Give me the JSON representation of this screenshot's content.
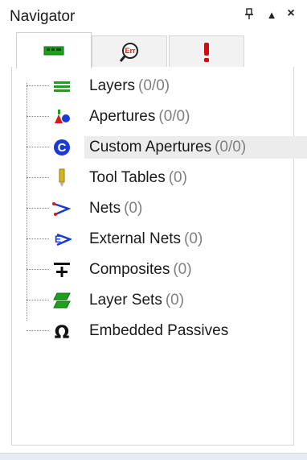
{
  "window": {
    "title": "Navigator",
    "pin_glyph": "ᵾ",
    "max_glyph": "▲",
    "close_glyph": "×"
  },
  "tabs": [
    {
      "name": "layers-tab",
      "icon": "pcb-board-icon",
      "active": true
    },
    {
      "name": "errors-tab",
      "icon": "magnifier-err-icon",
      "active": false
    },
    {
      "name": "alerts-tab",
      "icon": "exclamation-icon",
      "active": false
    }
  ],
  "tree": {
    "items": [
      {
        "label": "Layers",
        "count": "(0/0)",
        "icon": "layers-icon"
      },
      {
        "label": "Apertures",
        "count": "(0/0)",
        "icon": "apertures-icon"
      },
      {
        "label": "Custom Apertures",
        "count": "(0/0)",
        "icon": "custom-apertures-icon"
      },
      {
        "label": "Tool Tables",
        "count": "(0)",
        "icon": "tool-tables-icon"
      },
      {
        "label": "Nets",
        "count": "(0)",
        "icon": "nets-icon"
      },
      {
        "label": "External Nets",
        "count": "(0)",
        "icon": "external-nets-icon"
      },
      {
        "label": "Composites",
        "count": "(0)",
        "icon": "composites-icon"
      },
      {
        "label": "Layer Sets",
        "count": "(0)",
        "icon": "layer-sets-icon"
      },
      {
        "label": "Embedded Passives",
        "count": "",
        "icon": "omega-icon"
      }
    ]
  },
  "colors": {
    "green": "#1aa31a",
    "blue": "#1a3ad8",
    "red": "#d81a1a",
    "gold": "#d8b41a"
  }
}
